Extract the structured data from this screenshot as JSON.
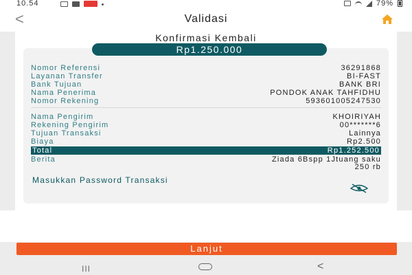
{
  "status_bar": {
    "time": "10.54",
    "battery_percent": "79%",
    "left_icons": [
      "envelope-icon",
      "message-icon",
      "app-badge-icon",
      "dot-icon"
    ],
    "right_icons": [
      "alarm-icon",
      "wifi-icon",
      "signal-icon",
      "battery-icon"
    ]
  },
  "header": {
    "back_icon": "chevron-left-icon",
    "title": "Validasi",
    "home_icon": "home-icon",
    "home_color": "#f5a623"
  },
  "confirmation": {
    "title": "Konfirmasi Kembali",
    "amount": "Rp1.250.000",
    "rows": [
      {
        "label": "Nomor Referensi",
        "value": "36291868"
      },
      {
        "label": "Layanan Transfer",
        "value": "BI-FAST"
      },
      {
        "label": "Bank Tujuan",
        "value": "BANK BRI"
      },
      {
        "label": "Nama Penerima",
        "value": "PONDOK ANAK TAHFIDHU"
      },
      {
        "label": "Nomor Rekening",
        "value": "593601005247530"
      },
      {
        "label": "Nama Pengirim",
        "value": "KHOIRIYAH"
      },
      {
        "label": "Rekening Pengirim",
        "value": "00*******6"
      },
      {
        "label": "Tujuan Transaksi",
        "value": "Lainnya"
      },
      {
        "label": "Biaya",
        "value": "Rp2.500"
      },
      {
        "label": "Total",
        "value": "Rp1.252.500"
      },
      {
        "label": "Berita",
        "value_line1": "Ziada 6Bspp 1Jtuang saku",
        "value_line2": "250 rb"
      }
    ],
    "password_label": "Masukkan Password Transaksi",
    "eye_icon": "eye-off-icon"
  },
  "actions": {
    "next_label": "Lanjut"
  },
  "nav_bar": {
    "recents_label": "III",
    "home_icon": "home-pill-icon",
    "back_label": "<"
  },
  "colors": {
    "teal": "#0f5a62",
    "label_teal": "#2f7d85",
    "orange": "#f05a22",
    "home_orange": "#f5a623"
  }
}
